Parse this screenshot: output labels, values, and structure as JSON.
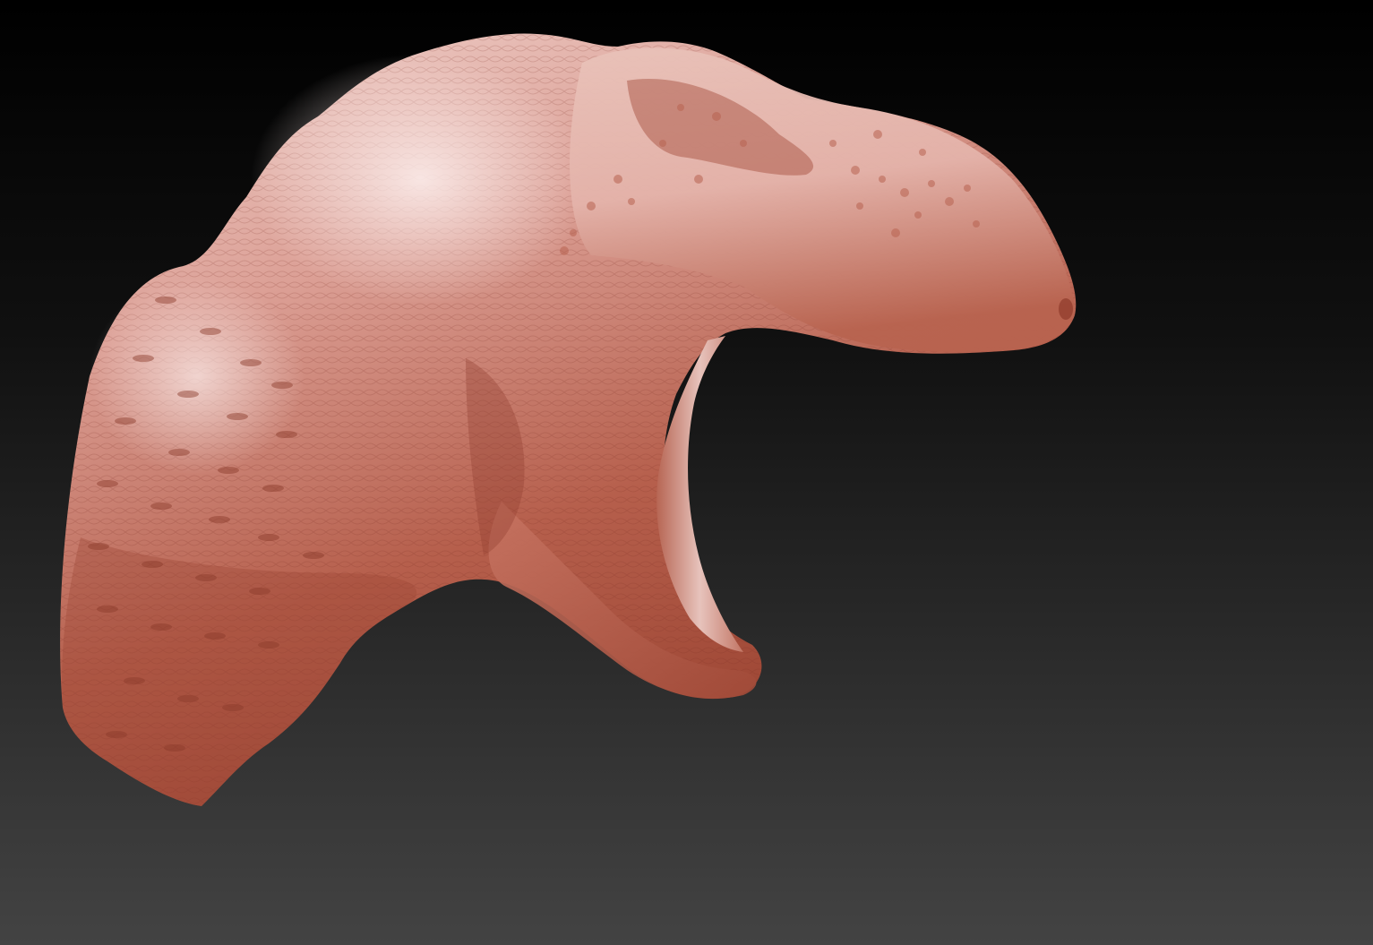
{
  "viewport": {
    "background_top": "#000000",
    "background_bottom": "#434343"
  },
  "model": {
    "subject": "dinosaur-head-sculpt",
    "material": {
      "base": "#a84f3e",
      "mid": "#c9766a",
      "highlight": "#f4dcd8",
      "shadow": "#6e2a1f"
    }
  }
}
